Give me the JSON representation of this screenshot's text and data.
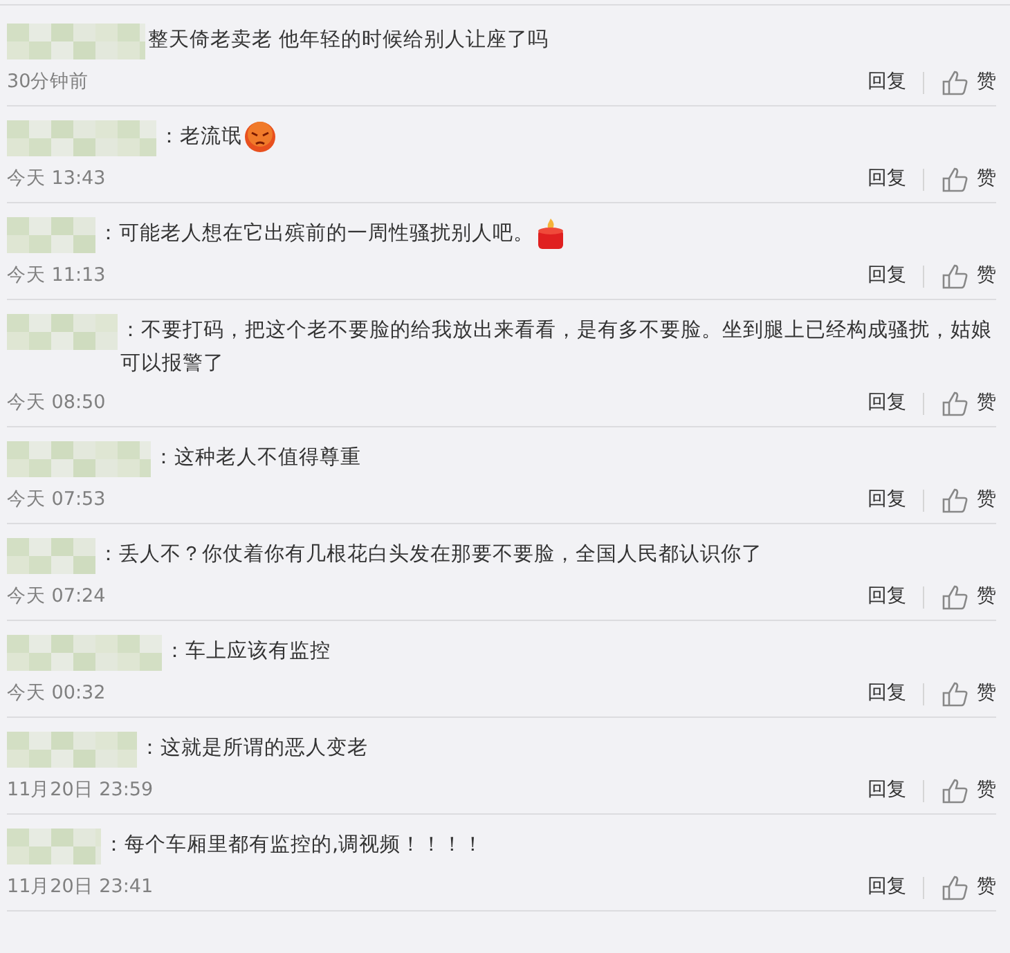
{
  "comments": [
    {
      "text": "整天倚老卖老 他年轻的时候给别人让座了吗",
      "time": "30分钟前",
      "reply": "回复",
      "like": "赞"
    },
    {
      "text": "：老流氓",
      "emoji": {
        "kind": "angry"
      },
      "time": "今天 13:43",
      "reply": "回复",
      "like": "赞"
    },
    {
      "text": "：可能老人想在它出殡前的一周性骚扰别人吧。",
      "emoji": {
        "kind": "candle"
      },
      "time": "今天 11:13",
      "reply": "回复",
      "like": "赞"
    },
    {
      "text": "：不要打码，把这个老不要脸的给我放出来看看，是有多不要脸。坐到腿上已经构成骚扰，姑娘可以报警了",
      "time": "今天 08:50",
      "reply": "回复",
      "like": "赞"
    },
    {
      "text": "：这种老人不值得尊重",
      "time": "今天 07:53",
      "reply": "回复",
      "like": "赞"
    },
    {
      "text": "：丢人不？你仗着你有几根花白头发在那要不要脸，全国人民都认识你了",
      "time": "今天 07:24",
      "reply": "回复",
      "like": "赞"
    },
    {
      "text": "：车上应该有监控",
      "time": "今天 00:32",
      "reply": "回复",
      "like": "赞"
    },
    {
      "text": "：这就是所谓的恶人变老",
      "time": "11月20日 23:59",
      "reply": "回复",
      "like": "赞"
    },
    {
      "text": "：每个车厢里都有监控的,调视频！！！！",
      "time": "11月20日 23:41",
      "reply": "回复",
      "like": "赞"
    }
  ]
}
